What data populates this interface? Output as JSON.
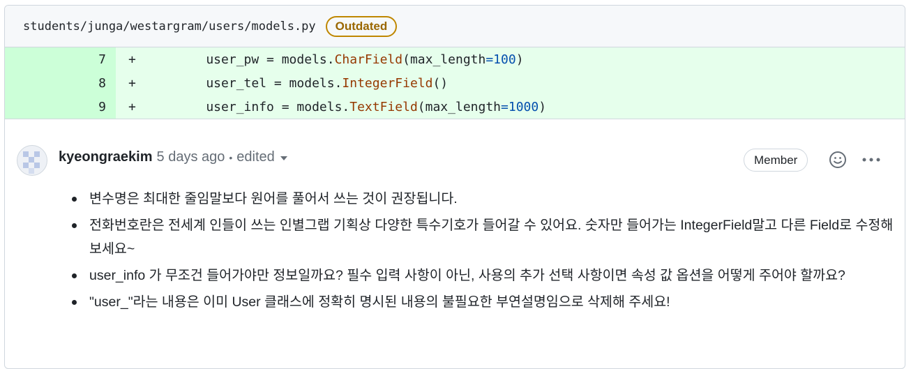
{
  "file": {
    "path": "students/junga/westargram/users/models.py",
    "badge": "Outdated"
  },
  "diff": [
    {
      "line": "7",
      "sign": "+",
      "parts": [
        {
          "t": "    user_pw = models.",
          "c": "plain"
        },
        {
          "t": "CharField",
          "c": "cls"
        },
        {
          "t": "(max_length",
          "c": "plain"
        },
        {
          "t": "=100",
          "c": "kw"
        },
        {
          "t": ")",
          "c": "plain"
        }
      ]
    },
    {
      "line": "8",
      "sign": "+",
      "parts": [
        {
          "t": "    user_tel = models.",
          "c": "plain"
        },
        {
          "t": "IntegerField",
          "c": "cls"
        },
        {
          "t": "()",
          "c": "plain"
        }
      ]
    },
    {
      "line": "9",
      "sign": "+",
      "parts": [
        {
          "t": "    user_info = models.",
          "c": "plain"
        },
        {
          "t": "TextField",
          "c": "cls"
        },
        {
          "t": "(max_length",
          "c": "plain"
        },
        {
          "t": "=1000",
          "c": "kw"
        },
        {
          "t": ")",
          "c": "plain"
        }
      ]
    }
  ],
  "comment": {
    "author": "kyeongraekim",
    "time": "5 days ago",
    "separator": "•",
    "edited": "edited",
    "role": "Member",
    "items": [
      "변수명은 최대한 줄임말보다 원어를 풀어서 쓰는 것이 권장됩니다.",
      "전화번호란은 전세계 인들이 쓰는 인별그랩 기획상 다양한 특수기호가 들어갈 수 있어요. 숫자만 들어가는 IntegerField말고 다른 Field로 수정해 보세요~",
      "user_info 가 무조건 들어가야만 정보일까요? 필수 입력 사항이 아닌, 사용의 추가 선택 사항이면 속성 값 옵션을 어떻게 주어야 할까요?",
      "\"user_\"라는 내용은 이미 User 클래스에 정확히 명시된 내용의 불필요한 부연설명임으로 삭제해 주세요!"
    ]
  },
  "colors": {
    "addition_bg": "#e6ffec",
    "addition_gutter": "#ccffd8",
    "outdated": "#9a6700"
  }
}
